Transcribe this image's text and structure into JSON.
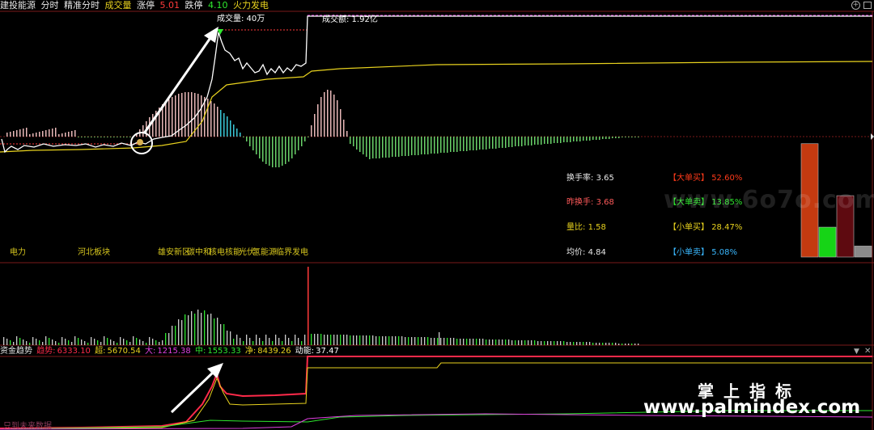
{
  "header": {
    "stock_name": "建投能源",
    "mode_minute": "分时",
    "mode_precise": "精准分时",
    "volume_label": "成交量",
    "limit_up_label": "涨停",
    "limit_up_value": "5.01",
    "limit_down_label": "跌停",
    "limit_down_value": "4.10",
    "sector_label": "火力发电"
  },
  "annotations": {
    "volume_peak": "成交量: 40万",
    "turnover": "成交额: 1.92亿"
  },
  "sectors": [
    "电力",
    "河北板块",
    "雄安新区",
    "碳中和",
    "核电核能",
    "光伏",
    "氢能源",
    "临界发电"
  ],
  "stats_left": [
    {
      "label": "换手率:",
      "value": "3.65",
      "color": "#e8e8e8"
    },
    {
      "label": "昨换手:",
      "value": "3.68",
      "color": "#ff5a5a"
    },
    {
      "label": "量比:",
      "value": "1.58",
      "color": "#e8d21e"
    },
    {
      "label": "均价:",
      "value": "4.84",
      "color": "#e8e8e8"
    }
  ],
  "stats_right": [
    {
      "label": "【大单买】",
      "value": "52.60%",
      "color": "#ff3a1a"
    },
    {
      "label": "【大单卖】",
      "value": "13.85%",
      "color": "#2ee82e"
    },
    {
      "label": "【小单买】",
      "value": "28.47%",
      "color": "#e8d21e"
    },
    {
      "label": "【小单卖】",
      "value": "5.08%",
      "color": "#3ab8ff"
    }
  ],
  "fund_trend": {
    "title": "资金趋势",
    "items": [
      {
        "label": "趋势:",
        "value": "6333.10",
        "color": "#ff2a4a"
      },
      {
        "label": "超:",
        "value": "5670.54",
        "color": "#e8d21e"
      },
      {
        "label": "大:",
        "value": "1215.38",
        "color": "#e040e0"
      },
      {
        "label": "中:",
        "value": "1553.33",
        "color": "#2ee82e"
      },
      {
        "label": "净:",
        "value": "8439.26",
        "color": "#e8d21e"
      },
      {
        "label": "动能:",
        "value": "37.47",
        "color": "#ffffff"
      }
    ],
    "footer": "只到未来数据"
  },
  "chart_data": {
    "type": "bar",
    "title": "",
    "categories": [
      "大单买",
      "大单卖",
      "小单买",
      "小单卖"
    ],
    "values": [
      52.6,
      13.85,
      28.47,
      5.08
    ],
    "ylim": [
      0,
      60
    ],
    "colors": [
      "#c43a10",
      "#16d416",
      "#5e0a10",
      "#8a8a8a"
    ]
  },
  "watermarks": {
    "site1": "www.6o7o.com",
    "cn": "掌上指标",
    "site2": "www.palmindex.com"
  },
  "colors": {
    "price_line": "#ffffff",
    "avg_line": "#e8d21e",
    "up_bar": "#ff3a3a",
    "down_bar": "#2ee82e",
    "grid": "#7a1a1a",
    "macd_pos": "#e8b8b8",
    "macd_neg": "#6ad26a"
  }
}
